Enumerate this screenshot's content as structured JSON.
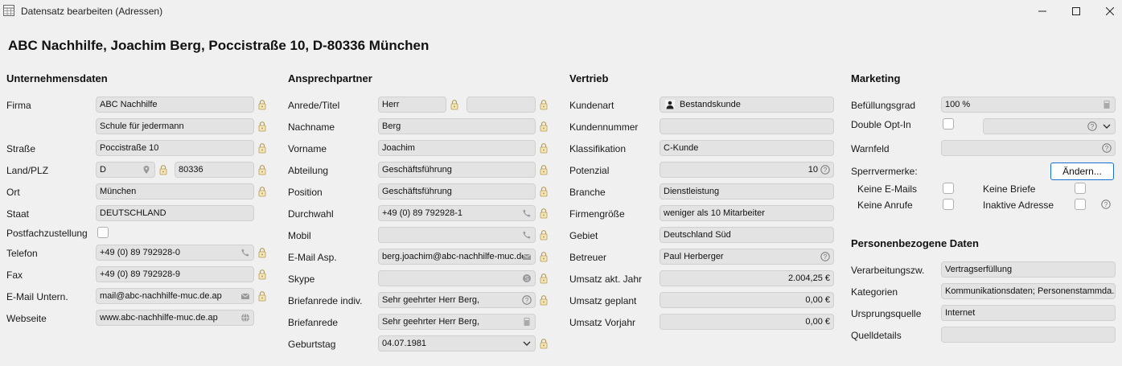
{
  "window": {
    "title": "Datensatz bearbeiten (Adressen)"
  },
  "heading": "ABC Nachhilfe, Joachim Berg, Poccistraße 10, D-80336 München",
  "unternehmen": {
    "title": "Unternehmensdaten",
    "labels": {
      "firma": "Firma",
      "strasse": "Straße",
      "land_plz": "Land/PLZ",
      "ort": "Ort",
      "staat": "Staat",
      "postfach": "Postfachzustellung",
      "telefon": "Telefon",
      "fax": "Fax",
      "email": "E-Mail Untern.",
      "webseite": "Webseite"
    },
    "values": {
      "firma1": "ABC Nachhilfe",
      "firma2": "Schule für jedermann",
      "strasse": "Poccistraße 10",
      "land": "D",
      "plz": "80336",
      "ort": "München",
      "staat": "DEUTSCHLAND",
      "telefon": "+49 (0) 89 792928-0",
      "fax": "+49 (0) 89 792928-9",
      "email": "mail@abc-nachhilfe-muc.de.ap",
      "webseite": "www.abc-nachhilfe-muc.de.ap"
    }
  },
  "ansprech": {
    "title": "Ansprechpartner",
    "labels": {
      "anrede": "Anrede/Titel",
      "nachname": "Nachname",
      "vorname": "Vorname",
      "abteilung": "Abteilung",
      "position": "Position",
      "durchwahl": "Durchwahl",
      "mobil": "Mobil",
      "email": "E-Mail Asp.",
      "skype": "Skype",
      "briefanrede_indiv": "Briefanrede indiv.",
      "briefanrede": "Briefanrede",
      "geburtstag": "Geburtstag"
    },
    "values": {
      "anrede": "Herr",
      "titel": "",
      "nachname": "Berg",
      "vorname": "Joachim",
      "abteilung": "Geschäftsführung",
      "position": "Geschäftsführung",
      "durchwahl": "+49 (0) 89 792928-1",
      "mobil": "",
      "email": "berg.joachim@abc-nachhilfe-muc.de",
      "skype": "",
      "briefanrede_indiv": "Sehr geehrter Herr Berg,",
      "briefanrede": "Sehr geehrter Herr Berg,",
      "geburtstag": "04.07.1981"
    }
  },
  "vertrieb": {
    "title": "Vertrieb",
    "labels": {
      "kundenart": "Kundenart",
      "kundennummer": "Kundennummer",
      "klassifikation": "Klassifikation",
      "potenzial": "Potenzial",
      "branche": "Branche",
      "firmengroesse": "Firmengröße",
      "gebiet": "Gebiet",
      "betreuer": "Betreuer",
      "umsatz_akt": "Umsatz akt. Jahr",
      "umsatz_geplant": "Umsatz geplant",
      "umsatz_vorjahr": "Umsatz Vorjahr"
    },
    "values": {
      "kundenart": "Bestandskunde",
      "kundennummer": "",
      "klassifikation": "C-Kunde",
      "potenzial": "10",
      "branche": "Dienstleistung",
      "firmengroesse": "weniger als 10 Mitarbeiter",
      "gebiet": "Deutschland Süd",
      "betreuer": "Paul Herberger",
      "umsatz_akt": "2.004,25 €",
      "umsatz_geplant": "0,00 €",
      "umsatz_vorjahr": "0,00 €"
    }
  },
  "marketing": {
    "title": "Marketing",
    "labels": {
      "befuellungsgrad": "Befüllungsgrad",
      "double_optin": "Double Opt-In",
      "warnfeld": "Warnfeld",
      "sperrvermerke": "Sperrvermerke:",
      "keine_emails": "Keine E-Mails",
      "keine_briefe": "Keine Briefe",
      "keine_anrufe": "Keine Anrufe",
      "inaktive_adresse": "Inaktive Adresse"
    },
    "values": {
      "befuellungsgrad": "100 %",
      "double_optin": "",
      "warnfeld": ""
    },
    "aendern_label": "Ändern..."
  },
  "personen": {
    "title": "Personenbezogene Daten",
    "labels": {
      "verarbeitung": "Verarbeitungszw.",
      "kategorien": "Kategorien",
      "ursprung": "Ursprungsquelle",
      "quelldetails": "Quelldetails"
    },
    "values": {
      "verarbeitung": "Vertragserfüllung",
      "kategorien": "Kommunikationsdaten; Personenstammda...",
      "ursprung": "Internet",
      "quelldetails": ""
    }
  }
}
